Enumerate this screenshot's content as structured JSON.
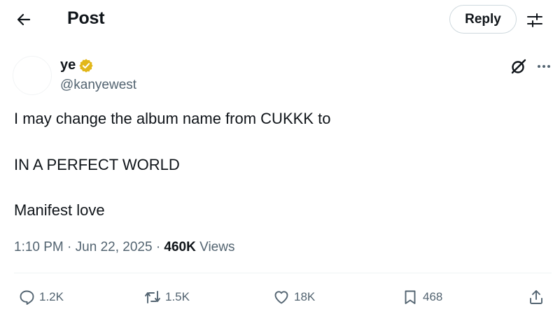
{
  "header": {
    "title": "Post",
    "reply_label": "Reply",
    "back_icon": "arrow-left-icon",
    "filter_icon": "sliders-icon"
  },
  "post": {
    "author_name": "ye",
    "author_handle": "@kanyewest",
    "verified_color": "#E2B719",
    "lines": [
      "I may change the album name from CUKKK to",
      "IN A PERFECT WORLD",
      "Manifest love"
    ],
    "time": "1:10 PM",
    "date": "Jun 22, 2025",
    "views_count": "460K",
    "views_label": "Views",
    "sep": "·"
  },
  "actions": {
    "replies": "1.2K",
    "reposts": "1.5K",
    "likes": "18K",
    "bookmarks": "468"
  }
}
